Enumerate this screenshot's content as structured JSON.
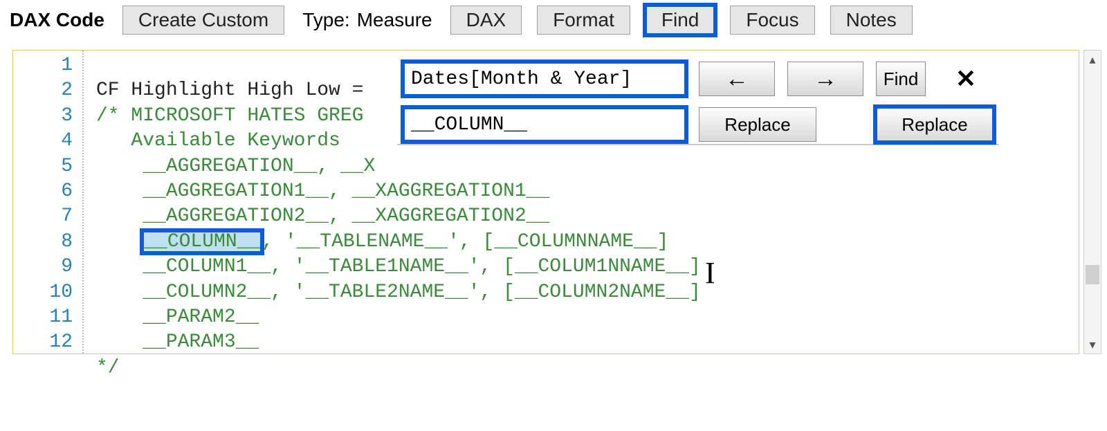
{
  "toolbar": {
    "title": "DAX Code",
    "buttons": {
      "create": "Create Custom",
      "dax": "DAX",
      "format": "Format",
      "find": "Find",
      "focus": "Focus",
      "notes": "Notes"
    },
    "type_label": "Type:",
    "type_value": "Measure"
  },
  "find_replace": {
    "find_value": "Dates[Month & Year]",
    "replace_value": "__COLUMN__",
    "prev": "←",
    "next": "→",
    "find_btn": "Find",
    "close": "✕",
    "replace": "Replace",
    "replace_all": "Replace"
  },
  "editor": {
    "line_numbers": [
      "1",
      "2",
      "3",
      "4",
      "5",
      "6",
      "7",
      "8",
      "9",
      "10",
      "11",
      "12"
    ],
    "line1_a": "CF Highlight High Low = ",
    "line2": "/* MICROSOFT HATES GREG",
    "line3": "   Available Keywords",
    "line4": "    __AGGREGATION__, __X",
    "line5": "    __AGGREGATION1__, __XAGGREGATION1__",
    "line6": "    __AGGREGATION2__, __XAGGREGATION2__",
    "line7_pre": "    ",
    "line7_sel": "__COLUMN__",
    "line7_post": ", '__TABLENAME__', [__COLUMNNAME__]",
    "line8": "    __COLUMN1__, '__TABLE1NAME__', [__COLUM1NNAME__]",
    "line9": "    __COLUMN2__, '__TABLE2NAME__', [__COLUMN2NAME__]",
    "line10": "    __PARAM2__",
    "line11": "    __PARAM3__",
    "line12": "*/"
  }
}
